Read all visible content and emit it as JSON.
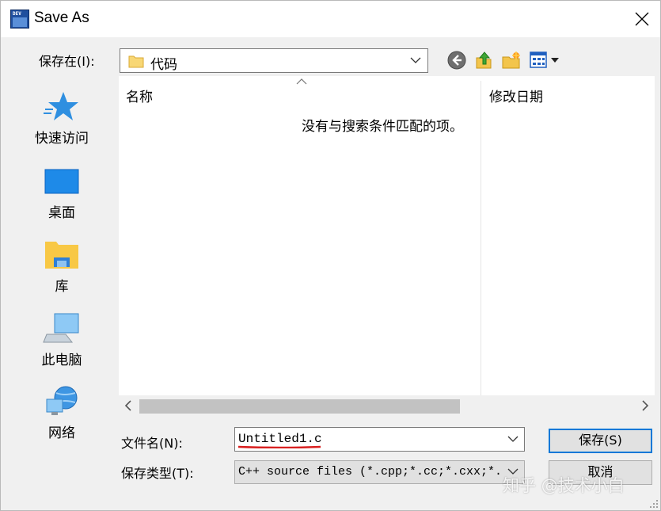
{
  "window": {
    "title": "Save As",
    "app_icon_text": "DEV"
  },
  "save_in": {
    "label": "保存在(I):",
    "value": "代码"
  },
  "toolbar": {
    "back_icon": "back-arrow-icon",
    "up_icon": "up-folder-icon",
    "new_folder_icon": "new-folder-icon",
    "view_icon": "view-menu-icon"
  },
  "places": [
    {
      "label": "快速访问",
      "icon": "star-icon"
    },
    {
      "label": "桌面",
      "icon": "desktop-icon"
    },
    {
      "label": "库",
      "icon": "library-folder-icon"
    },
    {
      "label": "此电脑",
      "icon": "computer-icon"
    },
    {
      "label": "网络",
      "icon": "network-icon"
    }
  ],
  "file_list": {
    "columns": [
      "名称",
      "修改日期"
    ],
    "empty_message": "没有与搜索条件匹配的项。"
  },
  "file_name": {
    "label": "文件名(N):",
    "value": "Untitled1.c"
  },
  "file_type": {
    "label": "保存类型(T):",
    "value": "C++ source files (*.cpp;*.cc;*.cxx;*.c++;*.hpp;*.hh;*.hxx;*.h++)"
  },
  "buttons": {
    "save": "保存(S)",
    "cancel": "取消"
  },
  "watermark": "知乎 @技术小白",
  "colors": {
    "accent": "#0078d7",
    "underline": "#d92020"
  }
}
